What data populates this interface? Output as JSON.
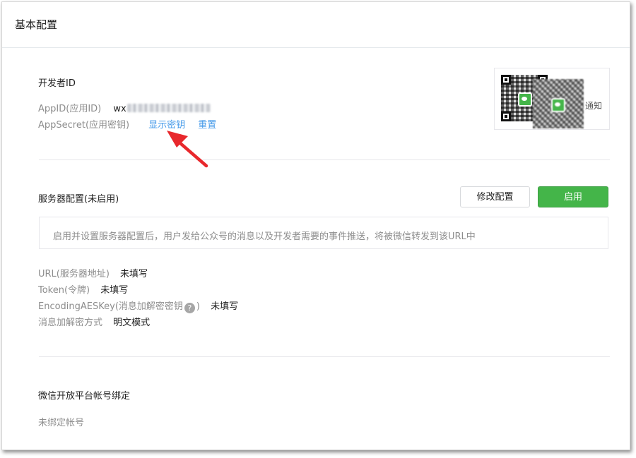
{
  "panel": {
    "title": "基本配置"
  },
  "developer": {
    "title": "开发者ID",
    "appid_label": "AppID(应用ID)",
    "appid_prefix": "wx",
    "appsecret_label": "AppSecret(应用密钥)",
    "show_secret_link": "显示密钥",
    "reset_link": "重置"
  },
  "qrcode": {
    "notify_text": "通知"
  },
  "server": {
    "title": "服务器配置(未启用)",
    "edit_button": "修改配置",
    "enable_button": "启用",
    "notice": "启用并设置服务器配置后，用户发给公众号的消息以及开发者需要的事件推送，将被微信转发到该URL中",
    "url_label": "URL(服务器地址)",
    "url_value": "未填写",
    "token_label": "Token(令牌)",
    "token_value": "未填写",
    "aeskey_label": "EncodingAESKey(消息加解密密钥",
    "aeskey_help": "?",
    "aeskey_close": ")",
    "aeskey_value": "未填写",
    "encrypt_label": "消息加解密方式",
    "encrypt_value": "明文模式"
  },
  "open_platform": {
    "title": "微信开放平台帐号绑定",
    "status": "未绑定帐号"
  },
  "colors": {
    "accent_green": "#44b549",
    "link_blue": "#459ae9",
    "annotation_red": "#e8282c"
  }
}
